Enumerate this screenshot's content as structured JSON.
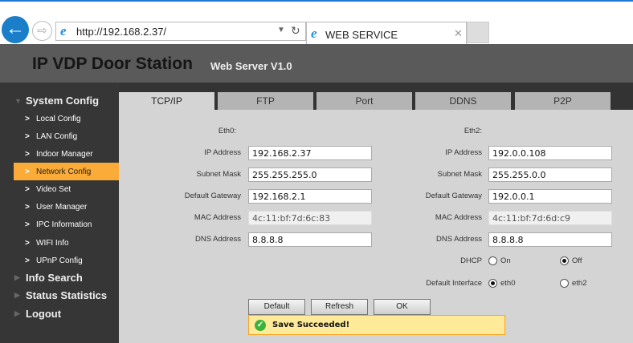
{
  "browser": {
    "url": "http://192.168.2.37/",
    "tab_title": "WEB SERVICE"
  },
  "header": {
    "title": "IP VDP Door Station",
    "version": "Web Server V1.0"
  },
  "sidebar": {
    "groups": [
      "System Config",
      "Info Search",
      "Status Statistics",
      "Logout"
    ],
    "items": [
      "Local Config",
      "LAN Config",
      "Indoor Manager",
      "Network Config",
      "Video Set",
      "User Manager",
      "IPC Information",
      "WIFI Info",
      "UPnP Config"
    ],
    "active_item": "Network Config"
  },
  "tabs": [
    "TCP/IP",
    "FTP",
    "Port",
    "DDNS",
    "P2P"
  ],
  "active_tab": "TCP/IP",
  "labels": {
    "ip": "IP Address",
    "mask": "Subnet Mask",
    "gw": "Default Gateway",
    "mac": "MAC Address",
    "dns": "DNS Address",
    "dhcp": "DHCP",
    "iface": "Default Interface"
  },
  "eth0": {
    "title": "Eth0:",
    "ip": "192.168.2.37",
    "mask": "255.255.255.0",
    "gw": "192.168.2.1",
    "mac": "4c:11:bf:7d:6c:83",
    "dns": "8.8.8.8"
  },
  "eth2": {
    "title": "Eth2:",
    "ip": "192.0.0.108",
    "mask": "255.255.0.0",
    "gw": "192.0.0.1",
    "mac": "4c:11:bf:7d:6d:c9",
    "dns": "8.8.8.8"
  },
  "dhcp": {
    "on": "On",
    "off": "Off",
    "selected": "Off"
  },
  "iface": {
    "eth0": "eth0",
    "eth2": "eth2",
    "selected": "eth0"
  },
  "buttons": {
    "default": "Default",
    "refresh": "Refresh",
    "ok": "OK"
  },
  "message": "Save Succeeded!",
  "colors": {
    "accent": "#fbab37",
    "header": "#5a5a5a",
    "sidebar": "#363636",
    "panel": "#d4d4d4"
  }
}
